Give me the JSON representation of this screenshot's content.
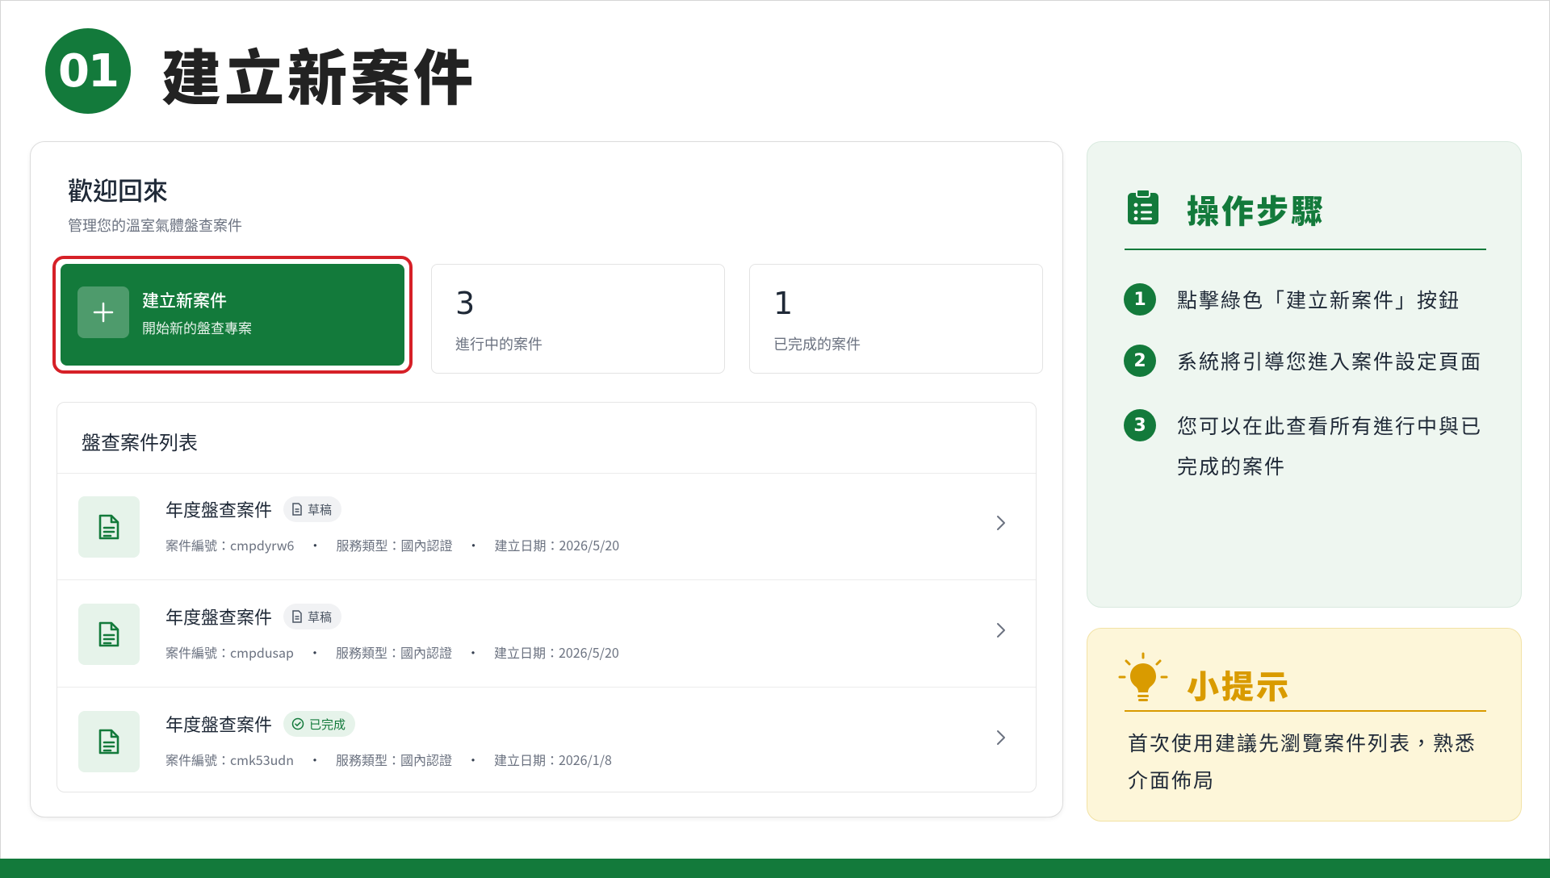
{
  "header": {
    "step_number": "01",
    "title": "建立新案件"
  },
  "dashboard": {
    "welcome_title": "歡迎回來",
    "welcome_subtitle": "管理您的溫室氣體盤查案件",
    "create_card": {
      "title": "建立新案件",
      "subtitle": "開始新的盤查專案",
      "icon": "plus-icon"
    },
    "stats": [
      {
        "value": "3",
        "label": "進行中的案件"
      },
      {
        "value": "1",
        "label": "已完成的案件"
      }
    ],
    "list": {
      "title": "盤查案件列表",
      "rows": [
        {
          "name": "年度盤查案件",
          "status": "草稿",
          "status_type": "draft",
          "case_no": "案件編號：cmpdyrw6",
          "service": "服務類型：國內認證",
          "created": "建立日期：2026/5/20"
        },
        {
          "name": "年度盤查案件",
          "status": "草稿",
          "status_type": "draft",
          "case_no": "案件編號：cmpdusap",
          "service": "服務類型：國內認證",
          "created": "建立日期：2026/5/20"
        },
        {
          "name": "年度盤查案件",
          "status": "已完成",
          "status_type": "done",
          "case_no": "案件編號：cmk53udn",
          "service": "服務類型：國內認證",
          "created": "建立日期：2026/1/8"
        }
      ]
    }
  },
  "steps": {
    "heading": "操作步驟",
    "items": [
      {
        "num": "1",
        "text": "點擊綠色「建立新案件」按鈕"
      },
      {
        "num": "2",
        "text": "系統將引導您進入案件設定頁面"
      },
      {
        "num": "3",
        "text": "您可以在此查看所有進行中與已完成的案件"
      }
    ]
  },
  "tips": {
    "heading": "小提示",
    "text": "首次使用建議先瀏覽案件列表，熟悉介面佈局"
  },
  "colors": {
    "primary": "#137a3b",
    "highlight": "#d62027",
    "tip": "#d99b00"
  }
}
